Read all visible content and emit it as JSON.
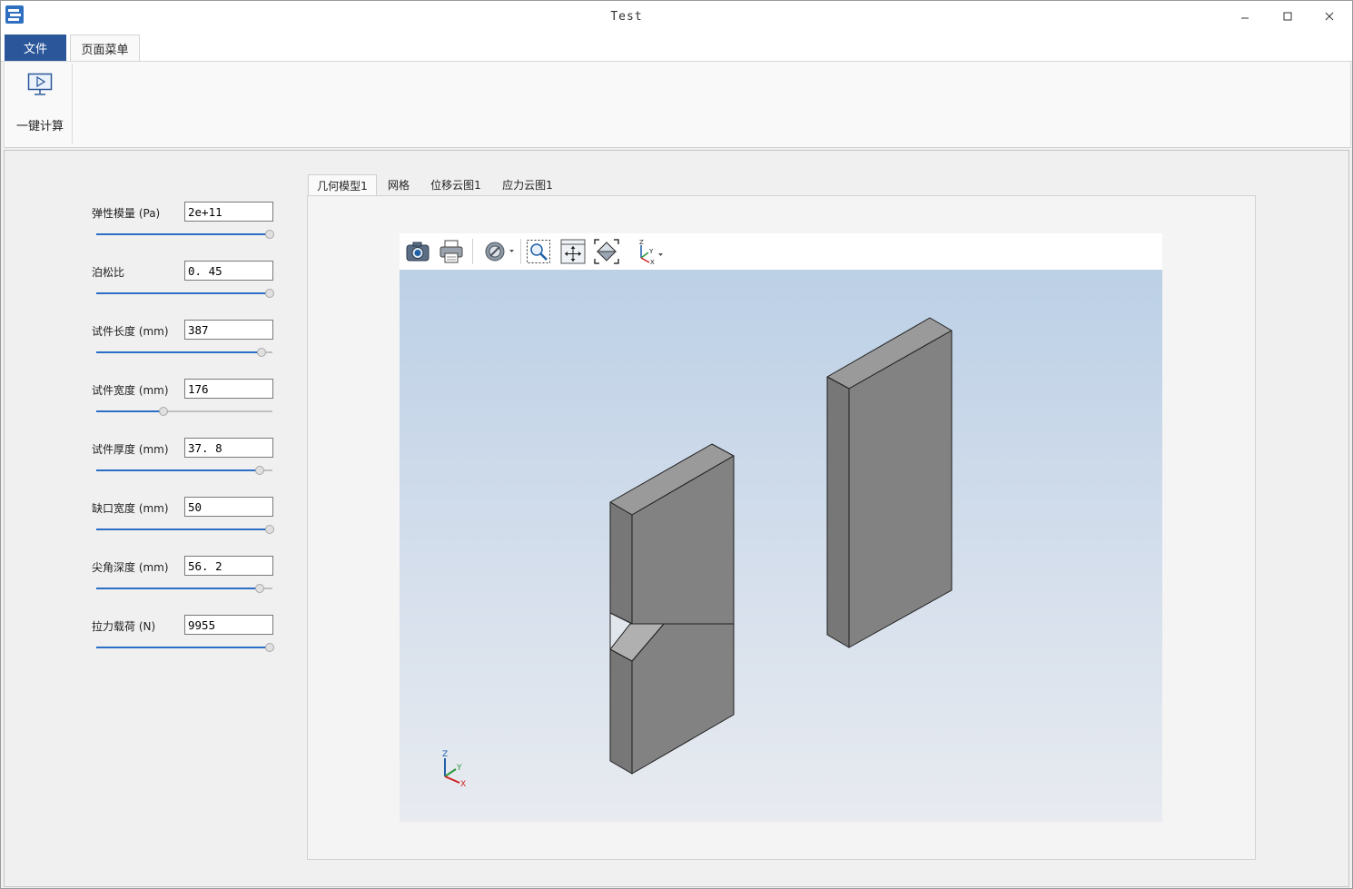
{
  "window": {
    "title": "Test"
  },
  "ribbon": {
    "tabs": [
      "文件",
      "页面菜单"
    ],
    "calc_button": "一键计算"
  },
  "params": [
    {
      "label": "弹性模量 (Pa)",
      "value": "2e+11",
      "slider": 1.0
    },
    {
      "label": "泊松比",
      "value": "0. 45",
      "slider": 1.0
    },
    {
      "label": "试件长度 (mm)",
      "value": "387",
      "slider": 0.95
    },
    {
      "label": "试件宽度 (mm)",
      "value": "176",
      "slider": 0.38
    },
    {
      "label": "试件厚度 (mm)",
      "value": "37. 8",
      "slider": 0.94
    },
    {
      "label": "缺口宽度 (mm)",
      "value": "50",
      "slider": 1.0
    },
    {
      "label": "尖角深度 (mm)",
      "value": "56. 2",
      "slider": 0.94
    },
    {
      "label": "拉力载荷 (N)",
      "value": "9955",
      "slider": 1.0
    }
  ],
  "view_tabs": [
    "几何模型1",
    "网格",
    "位移云图1",
    "应力云图1"
  ],
  "active_view_tab": 0,
  "toolbar_icons": [
    "camera-icon",
    "printer-icon",
    "hide-icon",
    "zoom-window-icon",
    "pan-icon",
    "fit-view-icon",
    "axes-orientation-icon"
  ],
  "colors": {
    "accent": "#2b579a",
    "slider": "#2b6ec6",
    "model_face": "#828282"
  },
  "triad": {
    "z": "Z",
    "y": "Y",
    "x": "X"
  }
}
